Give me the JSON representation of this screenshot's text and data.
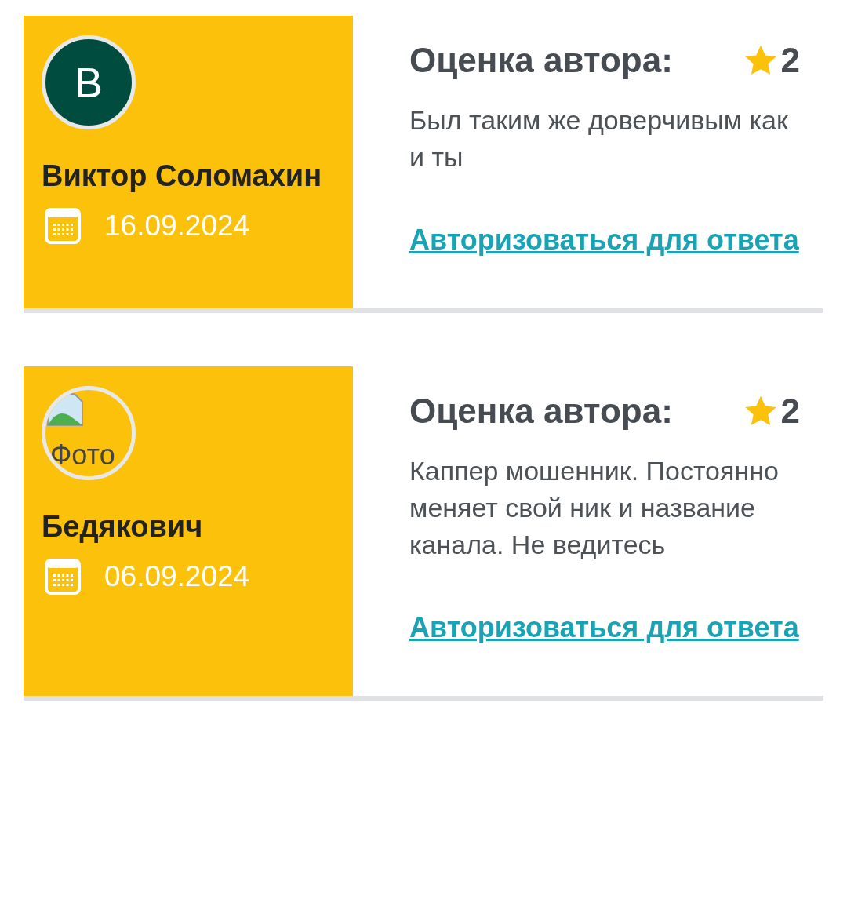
{
  "reviews": [
    {
      "author": {
        "name": "Виктор Соломахин",
        "avatar": {
          "kind": "letter",
          "text": "В",
          "color": "#004d40"
        }
      },
      "date": "16.09.2024",
      "rating_label": "Оценка автора:",
      "rating": "2",
      "comment": "Был таким же доверчивым как и ты",
      "reply_link": "Авторизоваться для ответа"
    },
    {
      "author": {
        "name": "Бедякович",
        "avatar": {
          "kind": "broken_image",
          "text": "Фото"
        }
      },
      "date": "06.09.2024",
      "rating_label": "Оценка автора:",
      "rating": "2",
      "comment": "Каппер мошенник. Постоянно меняет свой ник и название канала. Не ведитесь",
      "reply_link": "Авторизоваться для ответа"
    }
  ]
}
